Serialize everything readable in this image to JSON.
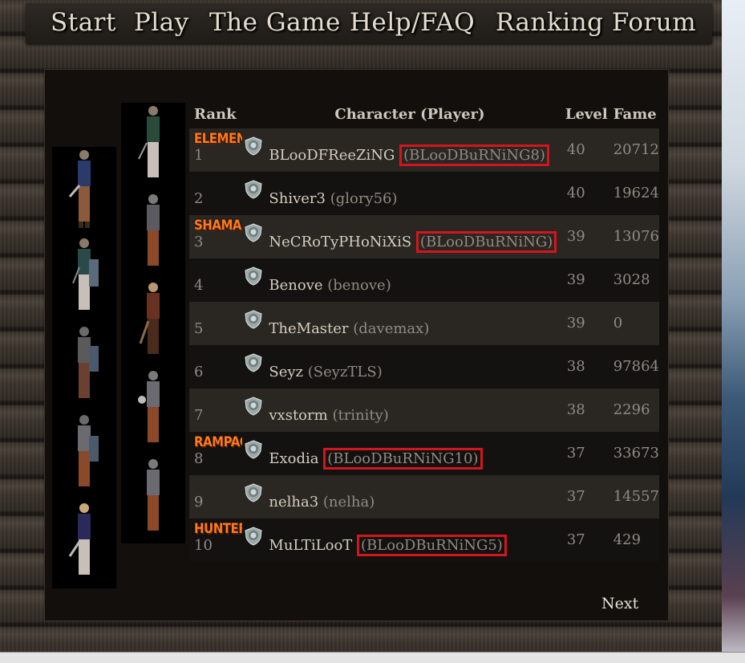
{
  "nav": {
    "items": [
      {
        "label": "Start"
      },
      {
        "label": "Play"
      },
      {
        "label": "The Game"
      },
      {
        "label": "Help/FAQ"
      },
      {
        "label": "Ranking"
      },
      {
        "label": "Forum"
      }
    ]
  },
  "table": {
    "headers": {
      "rank": "Rank",
      "character": "Character (Player)",
      "level": "Level",
      "fame": "Fame"
    },
    "rows": [
      {
        "rank": "1",
        "class_label": "ELEMENTALIST",
        "character": "BLooDFReeZiNG",
        "player": "(BLooDBuRNiNG8)",
        "level": "40",
        "fame": "20712",
        "highlighted": true
      },
      {
        "rank": "2",
        "class_label": "",
        "character": "Shiver3",
        "player": "(glory56)",
        "level": "40",
        "fame": "19624",
        "highlighted": false
      },
      {
        "rank": "3",
        "class_label": "SHAMAN",
        "character": "NeCRoTyPHoNiXiS",
        "player": "(BLooDBuRNiNG)",
        "level": "39",
        "fame": "13076",
        "highlighted": true
      },
      {
        "rank": "4",
        "class_label": "",
        "character": "Benove",
        "player": "(benove)",
        "level": "39",
        "fame": "3028",
        "highlighted": false
      },
      {
        "rank": "5",
        "class_label": "",
        "character": "TheMaster",
        "player": "(davemax)",
        "level": "39",
        "fame": "0",
        "highlighted": false
      },
      {
        "rank": "6",
        "class_label": "",
        "character": "Seyz",
        "player": "(SeyzTLS)",
        "level": "38",
        "fame": "97864",
        "highlighted": false
      },
      {
        "rank": "7",
        "class_label": "",
        "character": "vxstorm",
        "player": "(trinity)",
        "level": "38",
        "fame": "2296",
        "highlighted": false
      },
      {
        "rank": "8",
        "class_label": "RAMPAGNER",
        "character": "Exodia",
        "player": "(BLooDBuRNiNG10)",
        "level": "37",
        "fame": "33673",
        "highlighted": true
      },
      {
        "rank": "9",
        "class_label": "",
        "character": "nelha3",
        "player": "(nelha)",
        "level": "37",
        "fame": "14557",
        "highlighted": false
      },
      {
        "rank": "10",
        "class_label": "HUNTER",
        "character": "MuLTiLooT",
        "player": "(BLooDBuRNiNG5)",
        "level": "37",
        "fame": "429",
        "highlighted": true
      }
    ]
  },
  "pagination": {
    "next_label": "Next"
  },
  "colors": {
    "highlight_box": "#d3161d",
    "class_label": "#ff7a1a"
  }
}
